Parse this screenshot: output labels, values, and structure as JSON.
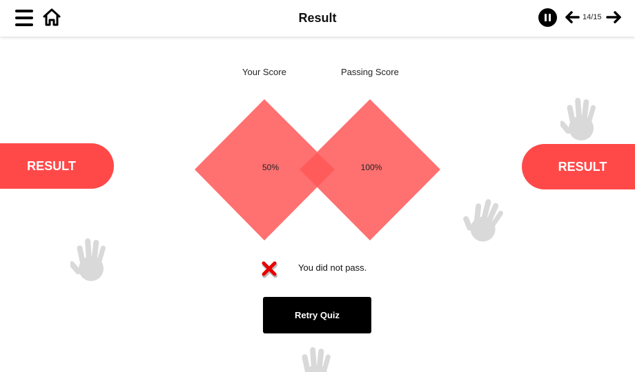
{
  "header": {
    "title": "Result",
    "menu_icon": "hamburger-menu-icon",
    "home_icon": "home-icon",
    "pause_icon": "pause-icon",
    "prev_icon": "arrow-left-icon",
    "next_icon": "arrow-right-icon",
    "page_counter": "14/15"
  },
  "side_banners": {
    "left_label": "RESULT",
    "right_label": "RESULT",
    "color": "#ff4949"
  },
  "scores": {
    "your_score_label": "Your Score",
    "passing_score_label": "Passing Score",
    "your_score_value": "50%",
    "passing_score_value": "100%",
    "diamond_color": "#ff7070",
    "overlap_color": "#ff5b5b"
  },
  "status": {
    "icon": "cross-icon",
    "message": "You did not pass.",
    "color": "#e60000"
  },
  "actions": {
    "retry_label": "Retry Quiz"
  },
  "decor": {
    "icon": "hand-icon"
  }
}
